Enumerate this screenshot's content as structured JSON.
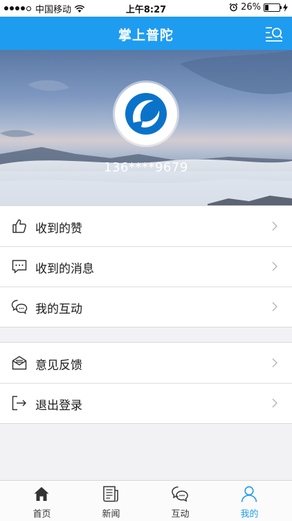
{
  "status_bar": {
    "carrier": "中国移动",
    "time": "上午8:27",
    "battery_percent": "26%",
    "battery_level": 0.26
  },
  "header": {
    "title": "掌上普陀"
  },
  "profile": {
    "phone": "136****9679"
  },
  "menu_group_1": [
    {
      "label": "收到的赞",
      "icon": "thumbs-up-icon"
    },
    {
      "label": "收到的消息",
      "icon": "chat-bubble-icon"
    },
    {
      "label": "我的互动",
      "icon": "two-bubbles-icon"
    }
  ],
  "menu_group_2": [
    {
      "label": "意见反馈",
      "icon": "envelope-icon"
    },
    {
      "label": "退出登录",
      "icon": "logout-icon"
    }
  ],
  "tabs": [
    {
      "label": "首页",
      "icon": "home-icon"
    },
    {
      "label": "新闻",
      "icon": "news-icon"
    },
    {
      "label": "互动",
      "icon": "chat-icon"
    },
    {
      "label": "我的",
      "icon": "person-icon",
      "active": true
    }
  ],
  "colors": {
    "accent": "#1e9cf0"
  }
}
